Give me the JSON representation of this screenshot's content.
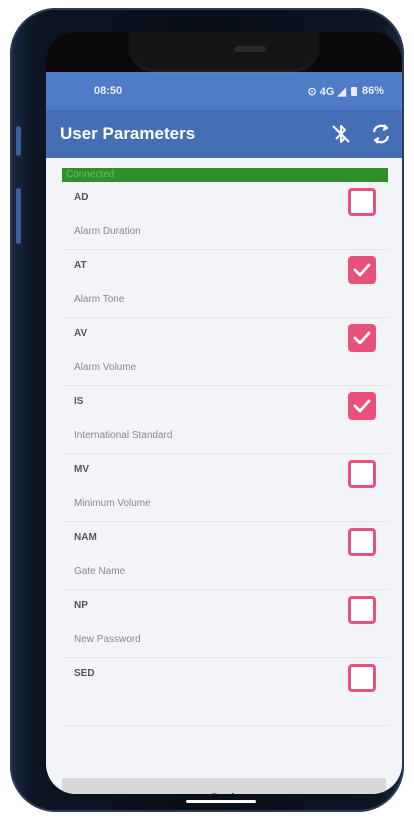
{
  "status_bar": {
    "time": "08:50",
    "indicators": "⊙ 4G ◢",
    "battery": "86%"
  },
  "toolbar": {
    "title": "User Parameters",
    "icons": [
      "bluetooth-disabled-icon",
      "refresh-icon"
    ]
  },
  "connection": {
    "status": "Connected",
    "bar_color": "#2f8f2a"
  },
  "params": [
    {
      "code": "AD",
      "description": "Alarm Duration",
      "checked": false
    },
    {
      "code": "AT",
      "description": "Alarm Tone",
      "checked": true
    },
    {
      "code": "AV",
      "description": "Alarm Volume",
      "checked": true
    },
    {
      "code": "IS",
      "description": "International Standard",
      "checked": true
    },
    {
      "code": "MV",
      "description": "Minimum Volume",
      "checked": false
    },
    {
      "code": "NAM",
      "description": "Gate Name",
      "checked": false
    },
    {
      "code": "NP",
      "description": "New Password",
      "checked": false
    },
    {
      "code": "SED",
      "description": "",
      "checked": false
    }
  ],
  "back_label": "Back",
  "colors": {
    "status_bar": "#4f7bc6",
    "toolbar": "#456fb4",
    "checkbox_accent": "#e8517c"
  }
}
